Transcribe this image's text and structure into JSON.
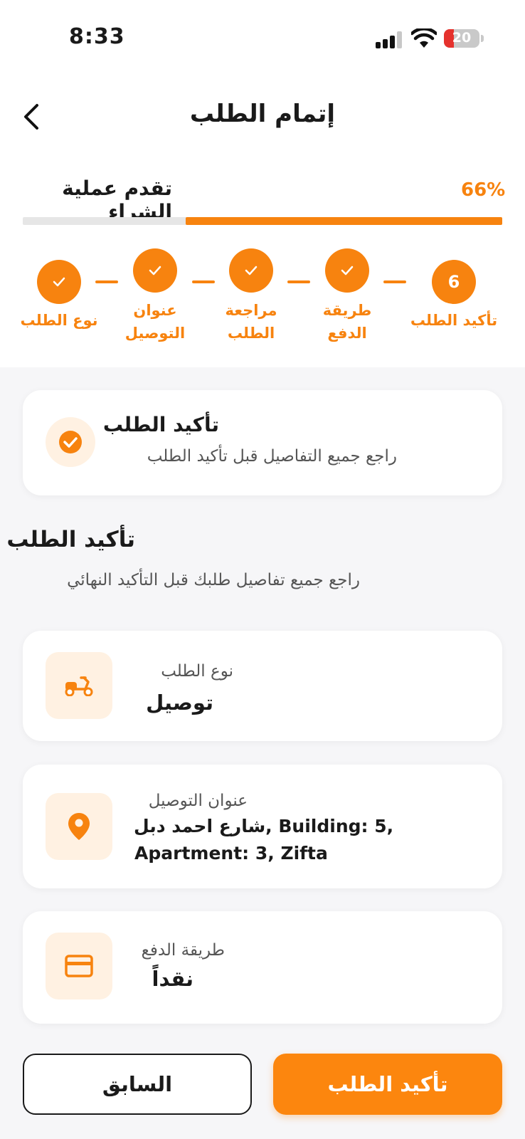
{
  "status_bar": {
    "time": "8:33",
    "battery": "20",
    "icons": [
      "cellular-signal-icon",
      "wifi-icon",
      "battery-icon"
    ]
  },
  "header": {
    "title": "إتمام الطلب",
    "back_icon": "chevron-left-icon"
  },
  "progress": {
    "label": "تقدم عملية الشراء",
    "percent_text": "66%",
    "value": 0.66
  },
  "steps": [
    {
      "label": "نوع الطلب",
      "state": "done"
    },
    {
      "label_line1": "عنوان",
      "label_line2": "التوصيل",
      "state": "done"
    },
    {
      "label_line1": "مراجعة",
      "label_line2": "الطلب",
      "state": "done"
    },
    {
      "label_line1": "طريقة",
      "label_line2": "الدفع",
      "state": "done"
    },
    {
      "label": "تأكيد الطلب",
      "number": "6",
      "state": "current"
    }
  ],
  "info_card": {
    "title": "تأكيد الطلب",
    "subtitle": "راجع جميع التفاصيل قبل تأكيد الطلب",
    "icon": "check-circle-icon"
  },
  "section": {
    "title": "تأكيد الطلب",
    "subtitle": "راجع جميع تفاصيل طلبك قبل التأكيد النهائي"
  },
  "details": {
    "order_type": {
      "label": "نوع الطلب",
      "value": "توصيل",
      "icon": "delivery-scooter-icon"
    },
    "address": {
      "label": "عنوان التوصيل",
      "value_street": "شارع احمد دبل",
      "value_line1_rest": ", Building: 5,",
      "value_line2": "Apartment: 3, Zifta",
      "icon": "location-pin-icon"
    },
    "payment": {
      "label": "طريقة الدفع",
      "value": "نقداً",
      "icon": "credit-card-icon"
    }
  },
  "buttons": {
    "previous": "السابق",
    "confirm": "تأكيد الطلب"
  },
  "colors": {
    "accent": "#f7830f",
    "accent_light": "#fff1e2",
    "background": "#f6f6f8"
  }
}
